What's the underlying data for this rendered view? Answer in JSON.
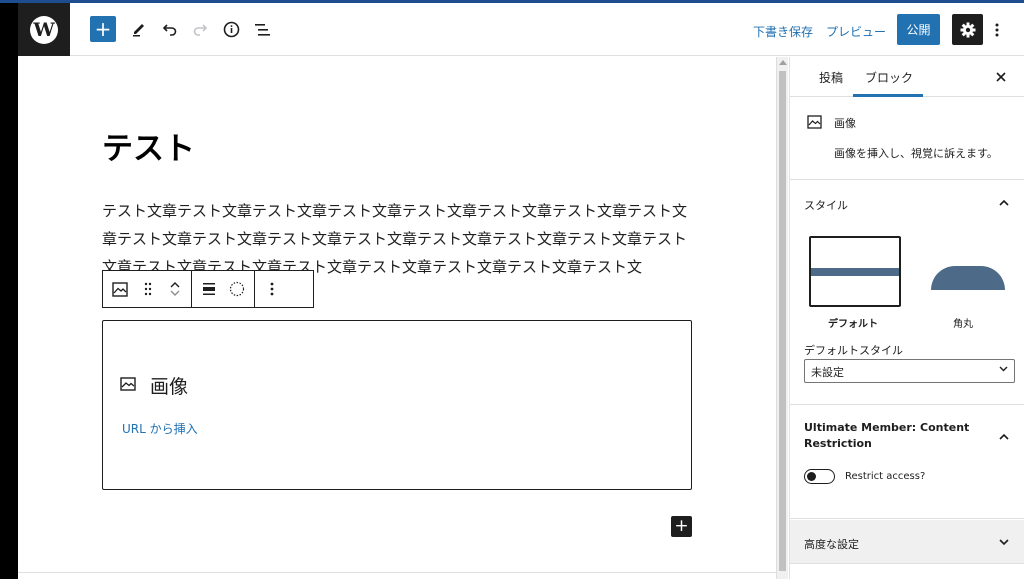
{
  "header": {
    "logo_letter": "W",
    "add_icon": "+",
    "edit_icon": "pencil-icon",
    "undo_icon": "undo-icon",
    "redo_icon": "redo-icon",
    "info_icon": "info-icon",
    "list_view_icon": "list-view-icon",
    "save_draft": "下書き保存",
    "preview": "プレビュー",
    "publish": "公開",
    "settings_icon": "gear-icon",
    "more_icon": "more-vertical-icon"
  },
  "editor": {
    "title": "テスト",
    "paragraph": "テスト文章テスト文章テスト文章テスト文章テスト文章テスト文章テスト文章テスト文章テスト文章テスト文章テスト文章テスト文章テスト文章テスト文章テスト文章テスト文章テスト文章テスト文章テスト文章テスト文章テスト文章テスト文章テスト文",
    "image_block": {
      "label": "画像",
      "url_link": "URL から挿入"
    }
  },
  "sidebar": {
    "tabs": [
      "投稿",
      "ブロック"
    ],
    "active_tab": "ブロック",
    "block_card": {
      "title": "画像",
      "description": "画像を挿入し、視覚に訴えます。"
    },
    "styles": {
      "title": "スタイル",
      "options": [
        "デフォルト",
        "角丸"
      ],
      "selected": "デフォルト",
      "default_style_label": "デフォルトスタイル",
      "default_style_value": "未設定"
    },
    "ultimate_member": {
      "title": "Ultimate Member: Content Restriction",
      "toggle_label": "Restrict access?",
      "toggle_on": false
    },
    "advanced": {
      "title": "高度な設定"
    }
  },
  "colors": {
    "accent": "#2271b1",
    "dark": "#1e1e1e",
    "style_preview": "#4d6b88"
  }
}
